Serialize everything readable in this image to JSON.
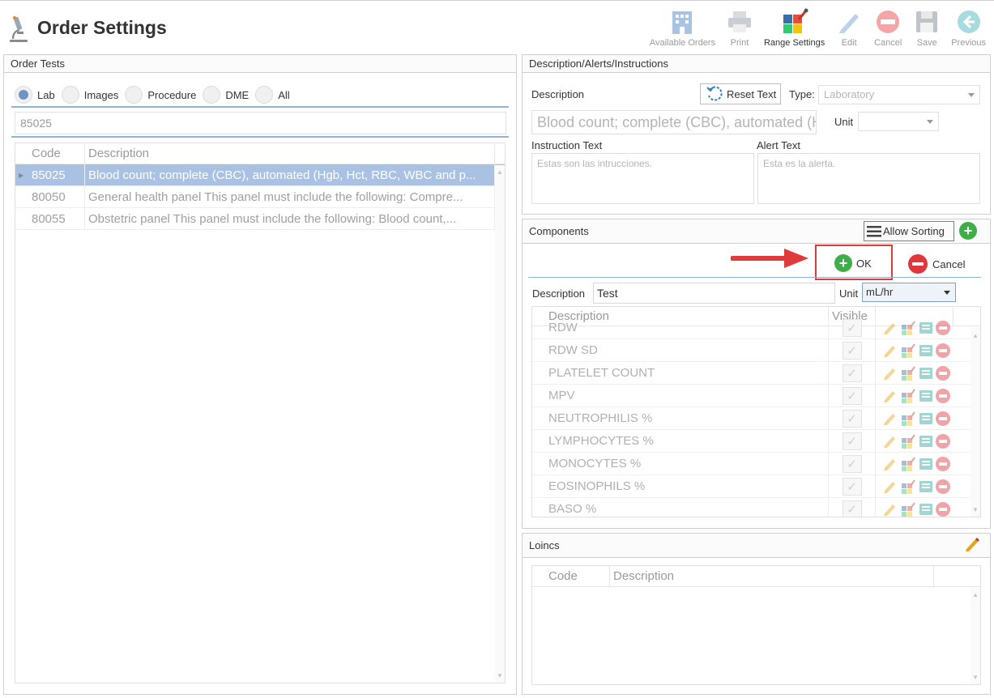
{
  "app": {
    "title": "Order Settings",
    "icon": "microscope-icon"
  },
  "toolbar": [
    {
      "label": "Available Orders",
      "icon": "building-icon",
      "active": false
    },
    {
      "label": "Print",
      "icon": "printer-icon",
      "active": false
    },
    {
      "label": "Range Settings",
      "icon": "range-settings-icon",
      "active": true
    },
    {
      "label": "Edit",
      "icon": "pencil-icon",
      "active": false
    },
    {
      "label": "Cancel",
      "icon": "cancel-icon",
      "active": false
    },
    {
      "label": "Save",
      "icon": "floppy-icon",
      "active": false
    },
    {
      "label": "Previous",
      "icon": "back-arrow-icon",
      "active": false
    }
  ],
  "order_tests": {
    "title": "Order Tests",
    "filters": [
      {
        "label": "Lab",
        "checked": true
      },
      {
        "label": "Images",
        "checked": false
      },
      {
        "label": "Procedure",
        "checked": false
      },
      {
        "label": "DME",
        "checked": false
      },
      {
        "label": "All",
        "checked": false
      }
    ],
    "search_value": "85025",
    "columns": [
      "Code",
      "Description"
    ],
    "rows": [
      {
        "code": "85025",
        "description": "Blood count; complete (CBC), automated (Hgb, Hct, RBC, WBC and p...",
        "selected": true
      },
      {
        "code": "80050",
        "description": "General health panel This panel must include the following: Compre...",
        "selected": false
      },
      {
        "code": "80055",
        "description": "Obstetric panel This panel must include the following: Blood count,...",
        "selected": false
      }
    ]
  },
  "description_panel": {
    "title": "Description/Alerts/Instructions",
    "description_label": "Description",
    "reset_label": "Reset Text",
    "type_label": "Type:",
    "type_value": "Laboratory",
    "description_value": "Blood count; complete (CBC), automated (H",
    "unit_label": "Unit",
    "unit_value": "",
    "instruction_label": "Instruction Text",
    "instruction_value": "Estas son las intrucciones.",
    "alert_label": "Alert Text",
    "alert_value": "Esta es la alerta."
  },
  "components": {
    "title": "Components",
    "allow_sorting_label": "Allow Sorting",
    "ok_label": "OK",
    "cancel_label": "Cancel",
    "description_label": "Description",
    "description_value": "Test",
    "unit_label": "Unit",
    "unit_value": "mL/hr",
    "columns": [
      "Description",
      "Visible"
    ],
    "rows": [
      {
        "name": "RDW"
      },
      {
        "name": "RDW SD"
      },
      {
        "name": "PLATELET COUNT"
      },
      {
        "name": "MPV"
      },
      {
        "name": "NEUTROPHILIS %"
      },
      {
        "name": "LYMPHOCYTES %"
      },
      {
        "name": "MONOCYTES %"
      },
      {
        "name": "EOSINOPHILS %"
      },
      {
        "name": "BASO %"
      }
    ]
  },
  "loincs": {
    "title": "Loincs",
    "columns": [
      "Code",
      "Description"
    ]
  },
  "colors": {
    "accent": "#6e94c6",
    "selected_row": "#a9c1e3",
    "green": "#3fae49",
    "red": "#e0373d",
    "annotation": "#e03b3b"
  }
}
